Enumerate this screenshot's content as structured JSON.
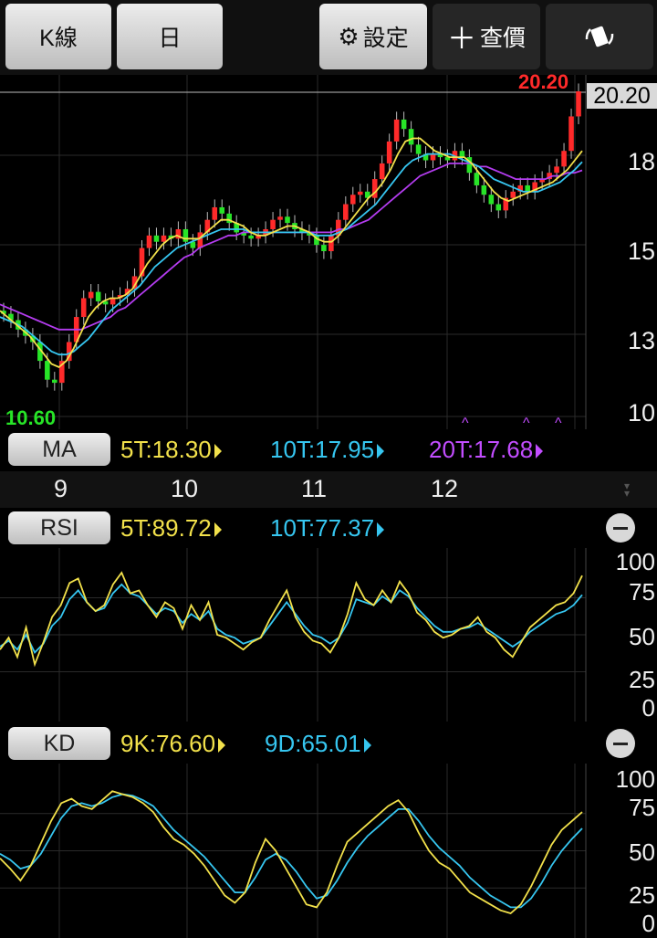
{
  "toolbar": {
    "kline_label": "K線",
    "period_label": "日",
    "settings_label": "設定",
    "lookup_label": "查價"
  },
  "price_chart": {
    "last_price_tag": "20.20",
    "high_label": "20.20",
    "low_label": "10.60",
    "y_ticks": [
      "18",
      "15",
      "13",
      "10"
    ]
  },
  "ma": {
    "button": "MA",
    "ma5": "5T:18.30",
    "ma10": "10T:17.95",
    "ma20": "20T:17.68"
  },
  "dates": [
    "9",
    "10",
    "11",
    "12"
  ],
  "rsi": {
    "button": "RSI",
    "rsi5": "5T:89.72",
    "rsi10": "10T:77.37",
    "y_ticks": [
      "100",
      "75",
      "50",
      "25",
      "0"
    ]
  },
  "kd": {
    "button": "KD",
    "k": "9K:76.60",
    "d": "9D:65.01",
    "y_ticks": [
      "100",
      "75",
      "50",
      "25",
      "0"
    ]
  },
  "colors": {
    "up": "#ff2a2a",
    "down": "#27e427",
    "ma5": "#f2e14b",
    "ma10": "#36c6f0",
    "ma20": "#b43cf0"
  },
  "chart_data": {
    "type": "line",
    "title": "",
    "price_series": {
      "close": [
        13.1,
        12.9,
        12.6,
        12.4,
        12.2,
        11.6,
        11.0,
        10.9,
        11.6,
        12.2,
        13.0,
        13.6,
        13.8,
        13.5,
        13.4,
        13.6,
        13.7,
        13.9,
        14.3,
        15.2,
        15.6,
        15.4,
        15.6,
        15.5,
        15.8,
        15.4,
        15.2,
        15.7,
        16.1,
        16.5,
        16.3,
        16.0,
        15.7,
        15.6,
        15.5,
        15.6,
        15.8,
        16.1,
        16.2,
        16.0,
        15.8,
        15.7,
        15.6,
        15.3,
        15.1,
        15.6,
        16.1,
        16.6,
        16.9,
        17.0,
        16.8,
        17.4,
        17.9,
        18.6,
        19.3,
        19.0,
        18.5,
        18.2,
        18.0,
        18.2,
        18.1,
        18.0,
        18.3,
        18.1,
        17.6,
        17.2,
        16.9,
        16.6,
        16.4,
        16.8,
        17.0,
        17.2,
        17.0,
        17.3,
        17.4,
        17.6,
        17.8,
        18.3,
        19.4,
        20.2
      ],
      "ma5": [
        13.2,
        13.0,
        12.8,
        12.6,
        12.4,
        12.1,
        11.8,
        11.5,
        11.4,
        11.6,
        12.0,
        12.5,
        13.0,
        13.3,
        13.5,
        13.6,
        13.6,
        13.7,
        13.9,
        14.3,
        14.7,
        15.0,
        15.3,
        15.5,
        15.6,
        15.5,
        15.5,
        15.5,
        15.7,
        15.9,
        16.1,
        16.1,
        16.0,
        15.9,
        15.7,
        15.6,
        15.6,
        15.7,
        15.8,
        15.9,
        15.9,
        15.8,
        15.7,
        15.5,
        15.4,
        15.4,
        15.6,
        15.9,
        16.2,
        16.5,
        16.8,
        17.0,
        17.3,
        17.7,
        18.2,
        18.6,
        18.7,
        18.7,
        18.5,
        18.3,
        18.2,
        18.1,
        18.1,
        18.1,
        17.9,
        17.6,
        17.3,
        17.0,
        16.8,
        16.7,
        16.8,
        16.9,
        17.0,
        17.1,
        17.2,
        17.3,
        17.5,
        17.7,
        18.0,
        18.3
      ],
      "ma10": [
        13.0,
        12.9,
        12.8,
        12.7,
        12.5,
        12.3,
        12.1,
        11.9,
        11.8,
        11.8,
        11.9,
        12.1,
        12.3,
        12.6,
        12.9,
        13.2,
        13.4,
        13.6,
        13.8,
        14.0,
        14.3,
        14.6,
        14.8,
        15.0,
        15.2,
        15.3,
        15.4,
        15.5,
        15.6,
        15.7,
        15.8,
        15.8,
        15.8,
        15.8,
        15.7,
        15.7,
        15.7,
        15.7,
        15.7,
        15.7,
        15.7,
        15.7,
        15.7,
        15.6,
        15.6,
        15.6,
        15.7,
        15.8,
        16.0,
        16.2,
        16.4,
        16.6,
        16.9,
        17.2,
        17.5,
        17.8,
        18.0,
        18.1,
        18.2,
        18.2,
        18.2,
        18.2,
        18.1,
        18.0,
        17.9,
        17.8,
        17.6,
        17.4,
        17.3,
        17.2,
        17.1,
        17.0,
        17.0,
        17.0,
        17.1,
        17.2,
        17.3,
        17.5,
        17.7,
        17.95
      ],
      "ma20": [
        13.4,
        13.3,
        13.2,
        13.1,
        13.0,
        12.9,
        12.8,
        12.7,
        12.6,
        12.6,
        12.6,
        12.6,
        12.7,
        12.8,
        12.9,
        13.0,
        13.2,
        13.3,
        13.5,
        13.7,
        13.9,
        14.1,
        14.3,
        14.5,
        14.7,
        14.9,
        15.0,
        15.2,
        15.3,
        15.4,
        15.5,
        15.6,
        15.6,
        15.7,
        15.7,
        15.7,
        15.7,
        15.7,
        15.7,
        15.7,
        15.7,
        15.7,
        15.7,
        15.7,
        15.7,
        15.7,
        15.8,
        15.8,
        15.9,
        16.0,
        16.1,
        16.3,
        16.5,
        16.7,
        16.9,
        17.1,
        17.3,
        17.5,
        17.6,
        17.7,
        17.8,
        17.9,
        17.9,
        17.9,
        17.9,
        17.8,
        17.8,
        17.7,
        17.6,
        17.5,
        17.4,
        17.4,
        17.4,
        17.4,
        17.4,
        17.5,
        17.5,
        17.6,
        17.6,
        17.68
      ]
    },
    "rsi_series": {
      "rsi5": [
        40,
        48,
        35,
        55,
        30,
        45,
        62,
        70,
        85,
        88,
        72,
        66,
        70,
        84,
        92,
        78,
        80,
        70,
        62,
        72,
        68,
        54,
        70,
        60,
        72,
        50,
        48,
        44,
        40,
        45,
        48,
        60,
        70,
        80,
        62,
        52,
        46,
        44,
        38,
        48,
        64,
        85,
        74,
        70,
        80,
        72,
        86,
        78,
        65,
        60,
        52,
        48,
        50,
        54,
        56,
        62,
        52,
        48,
        40,
        35,
        45,
        55,
        60,
        65,
        70,
        72,
        78,
        90
      ],
      "rsi10": [
        42,
        46,
        40,
        50,
        38,
        44,
        56,
        62,
        74,
        80,
        72,
        66,
        68,
        78,
        84,
        78,
        76,
        70,
        64,
        68,
        66,
        58,
        64,
        60,
        66,
        54,
        50,
        48,
        44,
        46,
        48,
        56,
        64,
        72,
        64,
        56,
        50,
        48,
        44,
        48,
        58,
        74,
        72,
        70,
        76,
        72,
        80,
        76,
        68,
        62,
        56,
        52,
        52,
        54,
        55,
        58,
        54,
        50,
        46,
        42,
        46,
        52,
        56,
        60,
        64,
        66,
        70,
        77
      ]
    },
    "kd_series": {
      "k": [
        45,
        38,
        30,
        40,
        55,
        70,
        82,
        85,
        80,
        78,
        84,
        90,
        88,
        86,
        82,
        76,
        66,
        58,
        54,
        48,
        40,
        30,
        20,
        15,
        22,
        42,
        58,
        50,
        38,
        26,
        14,
        12,
        22,
        40,
        56,
        62,
        68,
        74,
        80,
        84,
        76,
        62,
        50,
        42,
        38,
        30,
        22,
        18,
        14,
        10,
        8,
        14,
        26,
        40,
        54,
        64,
        70,
        76
      ],
      "d": [
        48,
        44,
        38,
        40,
        48,
        60,
        72,
        80,
        82,
        80,
        82,
        86,
        88,
        87,
        84,
        80,
        72,
        64,
        58,
        52,
        46,
        38,
        30,
        22,
        22,
        32,
        44,
        48,
        44,
        36,
        26,
        18,
        20,
        30,
        42,
        52,
        60,
        66,
        72,
        78,
        78,
        70,
        60,
        52,
        46,
        40,
        32,
        26,
        20,
        16,
        12,
        12,
        18,
        28,
        40,
        50,
        58,
        65
      ]
    },
    "price_ylim": [
      10.0,
      20.2
    ],
    "indicator_ylim": [
      0,
      100
    ],
    "x_ticks": [
      "9",
      "10",
      "11",
      "12"
    ],
    "grid": true
  }
}
